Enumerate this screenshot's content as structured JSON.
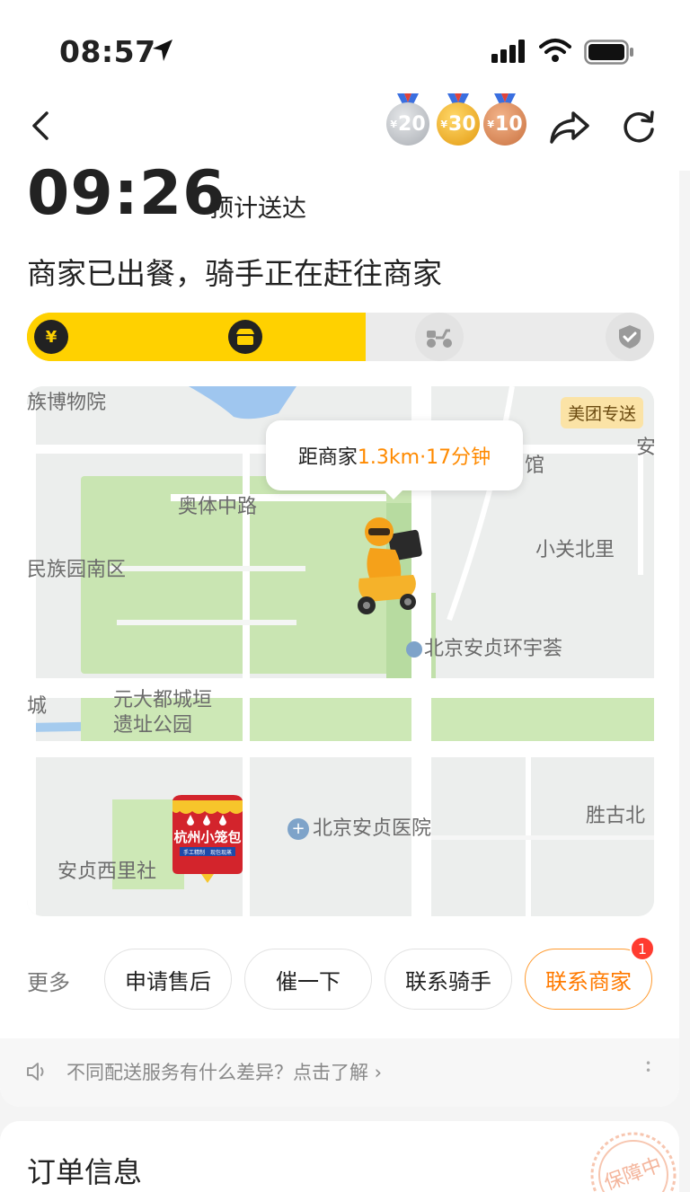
{
  "status_bar": {
    "time": "08:57"
  },
  "header": {
    "medals": [
      {
        "symbol": "¥",
        "value": "20",
        "color": "#b9bcc1"
      },
      {
        "symbol": "¥",
        "value": "30",
        "color": "#f2b21c"
      },
      {
        "symbol": "¥",
        "value": "10",
        "color": "#d98a55"
      }
    ]
  },
  "eta": {
    "time": "09:26",
    "label": "预计送达"
  },
  "status": {
    "text": "商家已出餐，骑手正在赶往商家"
  },
  "progress": {
    "fraction": 0.54,
    "active_color": "#ffd100",
    "steps": [
      "paid-icon",
      "store-icon",
      "rider-icon",
      "delivered-icon"
    ]
  },
  "map": {
    "badge": "美团专送",
    "distance_prefix": "距商家",
    "distance_value": "1.3km·17分钟",
    "labels": {
      "museum": "族博物院",
      "ao_ti_road": "奥体中路",
      "minzu_garden": "民族园南区",
      "xiaoguan": "小关北里",
      "huanyu": "北京安贞环宇荟",
      "yuan_park_1": "元大都城垣",
      "yuan_park_2": "遗址公园",
      "city": "城",
      "anzhen_hospital": "北京安贞医院",
      "shenggu": "胜古北",
      "anzhen_xili": "安贞西里社",
      "guan": "馆",
      "an": "安"
    },
    "store_sign": {
      "name": "杭州小笼包",
      "line1": "手工精制",
      "line2": "现包现蒸"
    }
  },
  "actions": {
    "more_label": "更多",
    "after_sale": "申请售后",
    "urge": "催一下",
    "contact_rider": "联系骑手",
    "contact_merchant": "联系商家",
    "merchant_badge": "1"
  },
  "tip": {
    "text": "不同配送服务有什么差异？点击了解 ›"
  },
  "order": {
    "title": "订单信息",
    "stamp": "保障中"
  },
  "colors": {
    "accent_yellow": "#ffd100",
    "accent_orange": "#ff7a00"
  }
}
